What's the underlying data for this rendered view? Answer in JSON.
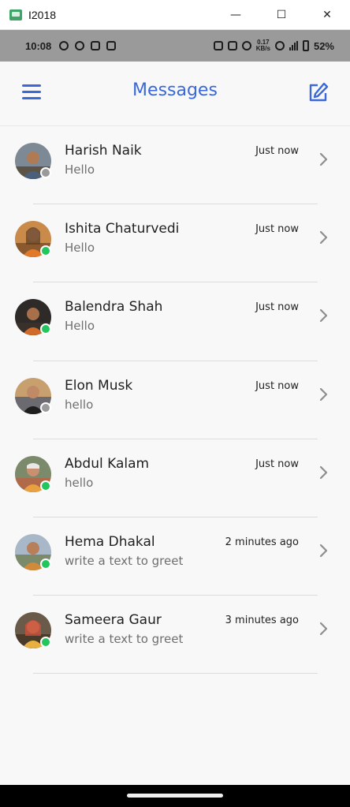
{
  "window": {
    "title": "I2018",
    "minimize": "—",
    "maximize": "☐",
    "close": "✕"
  },
  "status_bar": {
    "time": "10:08",
    "speed_value": "0.17",
    "speed_unit": "KB/s",
    "battery": "52%"
  },
  "header": {
    "title": "Messages"
  },
  "icons": {
    "menu": "menu-icon",
    "compose": "compose-icon",
    "chevron": "chevron-right-icon",
    "status_online": "online-dot",
    "status_offline": "offline-dot"
  },
  "colors": {
    "accent": "#3a68d8",
    "online": "#22c55e",
    "offline": "#9a9a9a"
  },
  "messages": [
    {
      "name": "Harish Naik",
      "preview": "Hello",
      "time": "Just now",
      "status": "offline"
    },
    {
      "name": "Ishita Chaturvedi",
      "preview": "Hello",
      "time": "Just now",
      "status": "online"
    },
    {
      "name": "Balendra Shah",
      "preview": "Hello",
      "time": "Just now",
      "status": "online"
    },
    {
      "name": "Elon Musk",
      "preview": "hello",
      "time": "Just now",
      "status": "offline"
    },
    {
      "name": "Abdul Kalam",
      "preview": "hello",
      "time": "Just now",
      "status": "online"
    },
    {
      "name": "Hema Dhakal",
      "preview": "write a text to greet",
      "time": "2 minutes ago",
      "status": "online"
    },
    {
      "name": "Sameera Gaur",
      "preview": "write a text to greet",
      "time": "3 minutes ago",
      "status": "online"
    }
  ]
}
